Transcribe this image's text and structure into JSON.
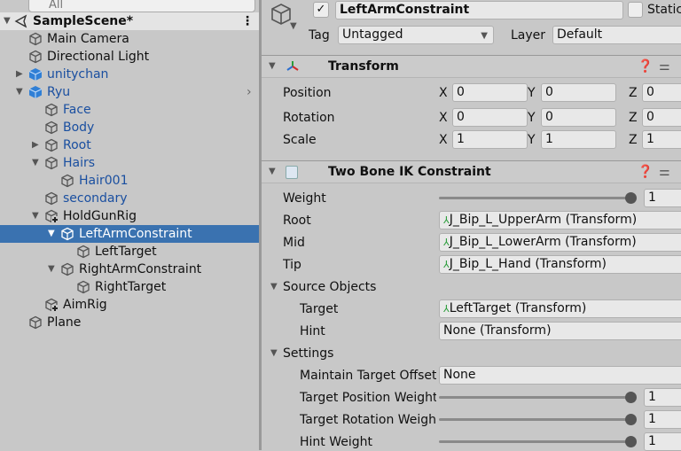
{
  "hierarchy": {
    "search_placeholder": "All",
    "scene": "SampleScene*",
    "items": [
      {
        "label": "Main Camera",
        "level": 1,
        "arrow": "",
        "color": "default",
        "icon": "gameobject"
      },
      {
        "label": "Directional Light",
        "level": 1,
        "arrow": "",
        "color": "default",
        "icon": "gameobject"
      },
      {
        "label": "unitychan",
        "level": 1,
        "arrow": "collapsed",
        "color": "blue",
        "icon": "prefab"
      },
      {
        "label": "Ryu",
        "level": 1,
        "arrow": "expanded",
        "color": "blue",
        "icon": "prefab"
      },
      {
        "label": "Face",
        "level": 2,
        "arrow": "",
        "color": "blue",
        "icon": "gameobject"
      },
      {
        "label": "Body",
        "level": 2,
        "arrow": "",
        "color": "blue",
        "icon": "gameobject"
      },
      {
        "label": "Root",
        "level": 2,
        "arrow": "collapsed",
        "color": "blue",
        "icon": "gameobject"
      },
      {
        "label": "Hairs",
        "level": 2,
        "arrow": "expanded",
        "color": "blue",
        "icon": "gameobject"
      },
      {
        "label": "Hair001",
        "level": 3,
        "arrow": "",
        "color": "blue",
        "icon": "gameobject"
      },
      {
        "label": "secondary",
        "level": 2,
        "arrow": "",
        "color": "blue",
        "icon": "gameobject"
      },
      {
        "label": "HoldGunRig",
        "level": 2,
        "arrow": "expanded",
        "color": "default",
        "icon": "gameobject-added"
      },
      {
        "label": "LeftArmConstraint",
        "level": 3,
        "arrow": "expanded",
        "color": "default",
        "icon": "gameobject",
        "selected": true
      },
      {
        "label": "LeftTarget",
        "level": 4,
        "arrow": "",
        "color": "default",
        "icon": "gameobject"
      },
      {
        "label": "RightArmConstraint",
        "level": 3,
        "arrow": "expanded",
        "color": "default",
        "icon": "gameobject"
      },
      {
        "label": "RightTarget",
        "level": 4,
        "arrow": "",
        "color": "default",
        "icon": "gameobject"
      },
      {
        "label": "AimRig",
        "level": 2,
        "arrow": "",
        "color": "default",
        "icon": "gameobject-added"
      },
      {
        "label": "Plane",
        "level": 1,
        "arrow": "",
        "color": "default",
        "icon": "gameobject"
      }
    ]
  },
  "inspector": {
    "object_name": "LeftArmConstraint",
    "active": true,
    "static_label": "Static",
    "static_checked": false,
    "tag_label": "Tag",
    "tag_value": "Untagged",
    "layer_label": "Layer",
    "layer_value": "Default",
    "transform": {
      "title": "Transform",
      "rows": [
        {
          "label": "Position",
          "x": "0",
          "y": "0",
          "z": "0"
        },
        {
          "label": "Rotation",
          "x": "0",
          "y": "0",
          "z": "0"
        },
        {
          "label": "Scale",
          "x": "1",
          "y": "1",
          "z": "1"
        }
      ],
      "axis_labels": [
        "X",
        "Y",
        "Z"
      ]
    },
    "ik": {
      "title": "Two Bone IK Constraint",
      "weight_label": "Weight",
      "weight_value": "1",
      "root_label": "Root",
      "root_value": "J_Bip_L_UpperArm (Transform)",
      "mid_label": "Mid",
      "mid_value": "J_Bip_L_LowerArm (Transform)",
      "tip_label": "Tip",
      "tip_value": "J_Bip_L_Hand (Transform)",
      "source_label": "Source Objects",
      "target_label": "Target",
      "target_value": "LeftTarget (Transform)",
      "hint_label": "Hint",
      "hint_value": "None (Transform)",
      "settings_label": "Settings",
      "maintain_label": "Maintain Target Offset",
      "maintain_value": "None",
      "tpw_label": "Target Position Weight",
      "tpw_value": "1",
      "trw_label": "Target Rotation Weight",
      "trw_value": "1",
      "hw_label": "Hint Weight",
      "hw_value": "1"
    }
  },
  "colors": {
    "selection": "#3a72b0",
    "prefab_text": "#1a4fa0",
    "prefab_icon": "#2f7fd6"
  }
}
